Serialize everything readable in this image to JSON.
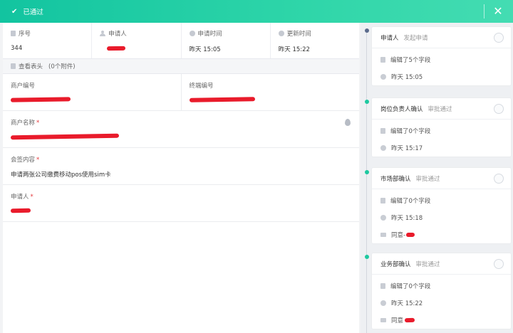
{
  "header": {
    "status_check": "✔",
    "status_text": "已通过",
    "close_glyph": "✕"
  },
  "info": {
    "serial": {
      "label": "序号",
      "value": "344"
    },
    "applicant": {
      "label": "申请人"
    },
    "apply_time": {
      "label": "申请时间",
      "value": "昨天 15:05"
    },
    "update_time": {
      "label": "更新时间",
      "value": "昨天 15:22"
    }
  },
  "attachments": {
    "label": "查看表头",
    "count": "(0个附件)"
  },
  "fields": {
    "merchant_no": {
      "label": "商户编号"
    },
    "terminal_no": {
      "label": "终端编号"
    },
    "merchant_name": {
      "label": "商户名称",
      "required": "*"
    },
    "sign_content": {
      "label": "会签内容",
      "required": "*",
      "value": "申请两张公司缴费移动pos使用sim卡"
    },
    "applicant": {
      "label": "申请人",
      "required": "*"
    }
  },
  "timeline": [
    {
      "name": "申请人",
      "status": "发起申请",
      "edited": "编辑了5个字段",
      "time": "昨天 15:05"
    },
    {
      "name": "岗位负责人确认",
      "status": "审批通过",
      "edited": "编辑了0个字段",
      "time": "昨天 15:17"
    },
    {
      "name": "市场部确认",
      "status": "审批通过",
      "edited": "编辑了0个字段",
      "time": "昨天 15:18",
      "comment": "同意-"
    },
    {
      "name": "业务部确认",
      "status": "审批通过",
      "edited": "编辑了0个字段",
      "time": "昨天 15:22",
      "comment": "同意"
    }
  ],
  "colors": {
    "accent": "#1ec9a0",
    "redaction": "#e91b2b"
  }
}
